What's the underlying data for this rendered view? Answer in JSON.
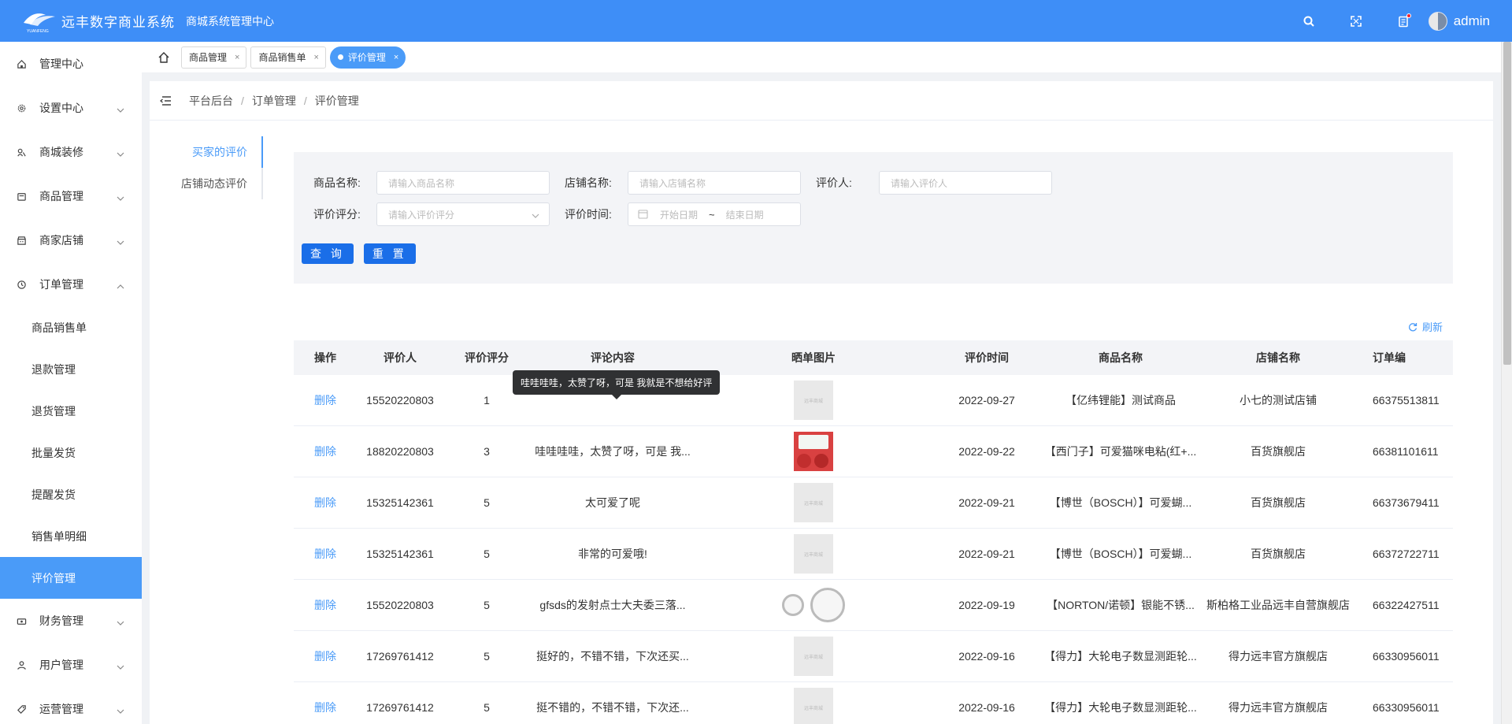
{
  "header": {
    "logo_name": "远丰数字商业系统",
    "logo_sub": "YUANFENG",
    "system_title": "商城系统管理中心",
    "user_name": "admin",
    "icons": [
      "search-icon",
      "fullscreen-icon",
      "notification-icon",
      "avatar"
    ]
  },
  "sidebar": {
    "items": [
      {
        "label": "管理中心",
        "icon": "home-icon"
      },
      {
        "label": "设置中心",
        "icon": "gear-icon"
      },
      {
        "label": "商城装修",
        "icon": "decorate-icon"
      },
      {
        "label": "商品管理",
        "icon": "goods-icon"
      },
      {
        "label": "商家店铺",
        "icon": "store-icon"
      },
      {
        "label": "订单管理",
        "icon": "order-icon"
      },
      {
        "label": "财务管理",
        "icon": "finance-icon"
      },
      {
        "label": "用户管理",
        "icon": "user-icon"
      },
      {
        "label": "运营管理",
        "icon": "operation-icon"
      }
    ],
    "order_sub": [
      "商品销售单",
      "退款管理",
      "退货管理",
      "批量发货",
      "提醒发货",
      "销售单明细",
      "评价管理"
    ]
  },
  "tabs": [
    {
      "label": "商品管理"
    },
    {
      "label": "商品销售单"
    },
    {
      "label": "评价管理"
    }
  ],
  "breadcrumb": [
    "平台后台",
    "订单管理",
    "评价管理"
  ],
  "side_tabs": [
    "买家的评价",
    "店铺动态评价"
  ],
  "filters": {
    "goods_name_label": "商品名称:",
    "goods_name_placeholder": "请输入商品名称",
    "shop_name_label": "店铺名称:",
    "shop_name_placeholder": "请输入店铺名称",
    "reviewer_label": "评价人:",
    "reviewer_placeholder": "请输入评价人",
    "score_label": "评价评分:",
    "score_placeholder": "请输入评价评分",
    "time_label": "评价时间:",
    "start_placeholder": "开始日期",
    "range_sep": "~",
    "end_placeholder": "结束日期",
    "query_button": "查 询",
    "reset_button": "重 置"
  },
  "refresh_label": "刷新",
  "table": {
    "columns": [
      "操作",
      "评价人",
      "评价评分",
      "评论内容",
      "晒单图片",
      "评价时间",
      "商品名称",
      "店铺名称",
      "订单编"
    ],
    "delete_label": "删除",
    "rows": [
      {
        "user": "15520220803",
        "score": "1",
        "content": "",
        "image": "placeholder",
        "time": "2022-09-27",
        "goods": "【亿纬锂能】测试商品",
        "shop": "小七的测试店铺",
        "order": "66375513811"
      },
      {
        "user": "18820220803",
        "score": "3",
        "content": "哇哇哇哇，太赞了呀，可是 我...",
        "image": "strawberry",
        "time": "2022-09-22",
        "goods": "【西门子】可爱猫咪电粘(红+...",
        "shop": "百货旗舰店",
        "order": "66381101611"
      },
      {
        "user": "15325142361",
        "score": "5",
        "content": "太可爱了呢",
        "image": "placeholder",
        "time": "2022-09-21",
        "goods": "【博世（BOSCH）】可爱蝴...",
        "shop": "百货旗舰店",
        "order": "66373679411"
      },
      {
        "user": "15325142361",
        "score": "5",
        "content": "非常的可爱哦!",
        "image": "placeholder",
        "time": "2022-09-21",
        "goods": "【博世（BOSCH）】可爱蝴...",
        "shop": "百货旗舰店",
        "order": "66372722711"
      },
      {
        "user": "15520220803",
        "score": "5",
        "content": "gfsds的发射点士大夫委三落...",
        "image": "gauges",
        "time": "2022-09-19",
        "goods": "【NORTON/诺顿】银能不锈...",
        "shop": "斯柏格工业品远丰自营旗舰店",
        "order": "66322427511"
      },
      {
        "user": "17269761412",
        "score": "5",
        "content": "挺好的，不错不错，下次还买...",
        "image": "placeholder",
        "time": "2022-09-16",
        "goods": "【得力】大轮电子数显测距轮...",
        "shop": "得力远丰官方旗舰店",
        "order": "66330956011"
      },
      {
        "user": "17269761412",
        "score": "5",
        "content": "挺不错的，不错不错，下次还...",
        "image": "placeholder",
        "time": "2022-09-16",
        "goods": "【得力】大轮电子数显测距轮...",
        "shop": "得力远丰官方旗舰店",
        "order": "66330956011"
      }
    ]
  },
  "tooltip": "哇哇哇哇，太赞了呀，可是 我就是不想给好评",
  "colors": {
    "header_blue": "#3e8ef7",
    "accent": "#4a9bf8",
    "button_blue": "#1a6ee8"
  }
}
